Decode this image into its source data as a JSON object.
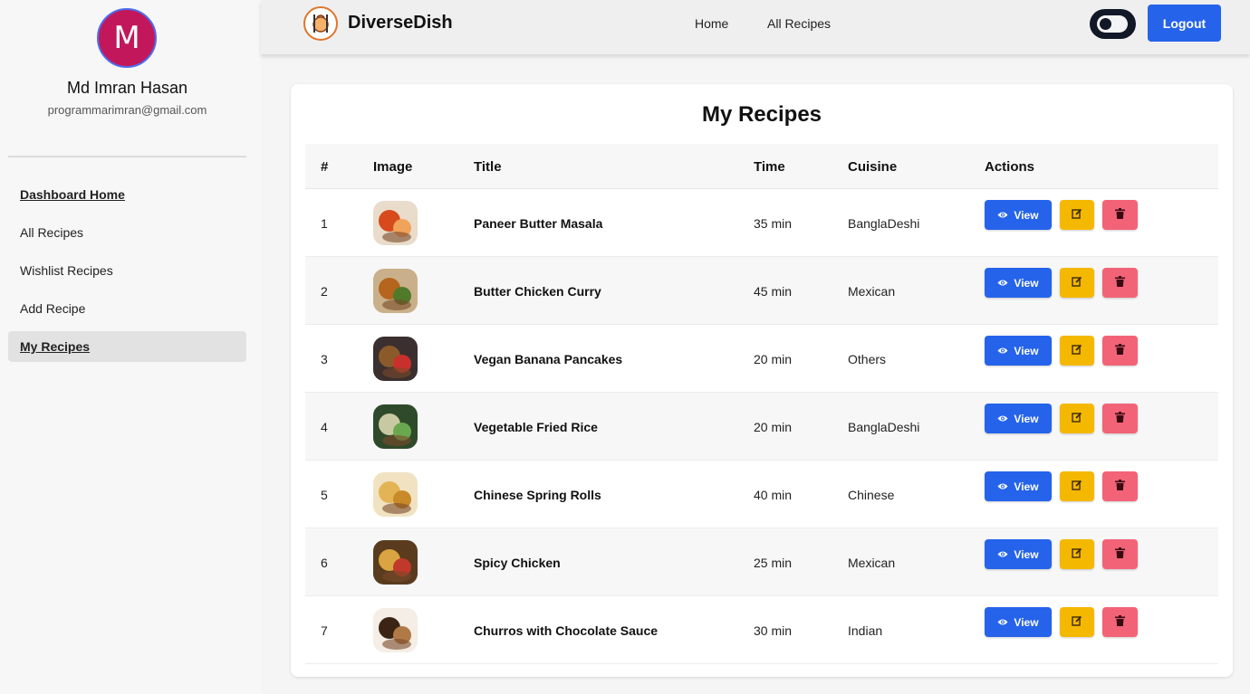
{
  "user": {
    "initial": "M",
    "name": "Md Imran Hasan",
    "email": "programmarimran@gmail.com"
  },
  "sidebar": {
    "items": [
      {
        "label": "Dashboard Home"
      },
      {
        "label": "All Recipes"
      },
      {
        "label": "Wishlist Recipes"
      },
      {
        "label": "Add Recipe"
      },
      {
        "label": "My Recipes"
      }
    ]
  },
  "navbar": {
    "brand": "DiverseDish",
    "links": [
      "Home",
      "All Recipes"
    ],
    "logout_label": "Logout"
  },
  "page": {
    "title": "My Recipes"
  },
  "table": {
    "headers": [
      "#",
      "Image",
      "Title",
      "Time",
      "Cuisine",
      "Actions"
    ],
    "view_label": "View",
    "rows": [
      {
        "num": "1",
        "title": "Paneer Butter Masala",
        "time": "35 min",
        "cuisine": "BanglaDeshi"
      },
      {
        "num": "2",
        "title": "Butter Chicken Curry",
        "time": "45 min",
        "cuisine": "Mexican"
      },
      {
        "num": "3",
        "title": "Vegan Banana Pancakes",
        "time": "20 min",
        "cuisine": "Others"
      },
      {
        "num": "4",
        "title": "Vegetable Fried Rice",
        "time": "20 min",
        "cuisine": "BanglaDeshi"
      },
      {
        "num": "5",
        "title": "Chinese Spring Rolls",
        "time": "40 min",
        "cuisine": "Chinese"
      },
      {
        "num": "6",
        "title": "Spicy Chicken",
        "time": "25 min",
        "cuisine": "Mexican"
      },
      {
        "num": "7",
        "title": "Churros with Chocolate Sauce",
        "time": "30 min",
        "cuisine": "Indian"
      }
    ]
  },
  "colors": {
    "primary": "#2563eb",
    "edit": "#f5b800",
    "delete": "#f26377",
    "avatar": "#c2185b"
  },
  "icons": {
    "view": "eye-icon",
    "edit": "edit-icon",
    "delete": "trash-icon"
  }
}
